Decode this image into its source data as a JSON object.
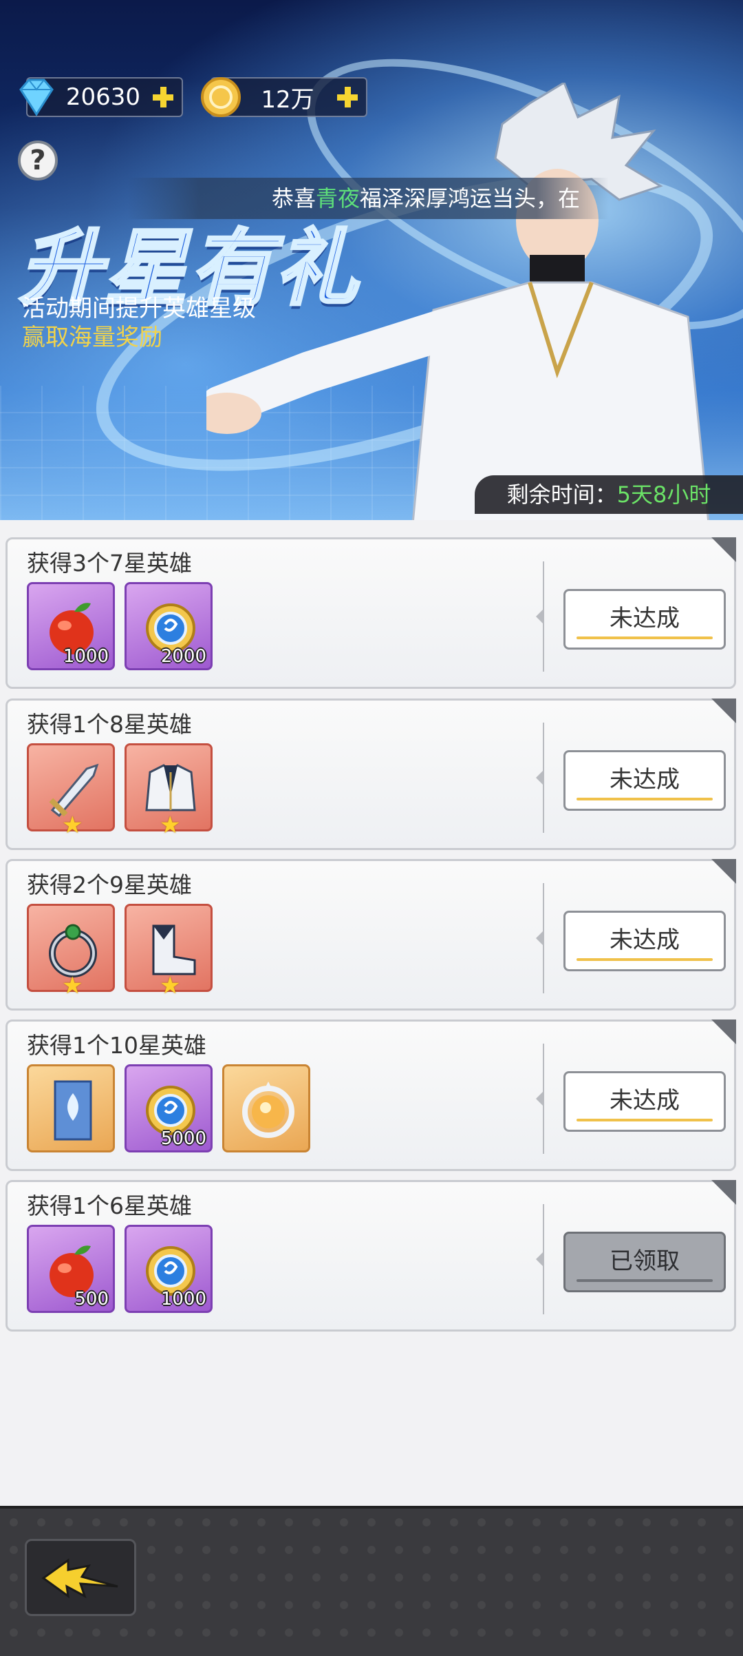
{
  "currency": {
    "diamonds": "20630",
    "coins": "12万"
  },
  "banner": {
    "marquee_prefix": "恭喜",
    "marquee_name": "青夜",
    "marquee_suffix": "福泽深厚鸿运当头，在",
    "title": "升星有礼",
    "subtitle_1": "活动期间提升英雄星级",
    "subtitle_2": "赢取海量奖励",
    "timer_label": "剩余时间：",
    "timer_value": "5天8小时"
  },
  "tasks": [
    {
      "title": "获得3个7星英雄",
      "status": "未达成",
      "rewards": [
        {
          "icon": "peach-icon",
          "rarity": "purple",
          "count": "1000"
        },
        {
          "icon": "exp-coin-icon",
          "rarity": "purple",
          "count": "2000"
        }
      ]
    },
    {
      "title": "获得1个8星英雄",
      "status": "未达成",
      "rewards": [
        {
          "icon": "sword-icon",
          "rarity": "red",
          "count": ""
        },
        {
          "icon": "armor-icon",
          "rarity": "red",
          "count": ""
        }
      ]
    },
    {
      "title": "获得2个9星英雄",
      "status": "未达成",
      "rewards": [
        {
          "icon": "ring-icon",
          "rarity": "red",
          "count": ""
        },
        {
          "icon": "boots-icon",
          "rarity": "red",
          "count": ""
        }
      ]
    },
    {
      "title": "获得1个10星英雄",
      "status": "未达成",
      "rewards": [
        {
          "icon": "banner-icon",
          "rarity": "gold",
          "count": ""
        },
        {
          "icon": "exp-coin-icon",
          "rarity": "purple",
          "count": "5000"
        },
        {
          "icon": "orb-icon",
          "rarity": "gold",
          "count": ""
        }
      ]
    },
    {
      "title": "获得1个6星英雄",
      "status": "已领取",
      "rewards": [
        {
          "icon": "peach-icon",
          "rarity": "purple",
          "count": "500"
        },
        {
          "icon": "exp-coin-icon",
          "rarity": "purple",
          "count": "1000"
        }
      ]
    }
  ],
  "colors": {
    "accent_green": "#6be267",
    "accent_yellow": "#f1d34b",
    "claimed_gray": "#a4a7ad"
  }
}
